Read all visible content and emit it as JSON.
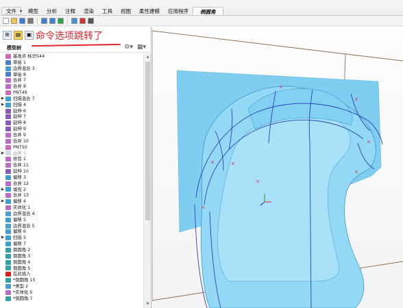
{
  "menu": {
    "items": [
      {
        "label": "文件",
        "dropdown": "▾"
      },
      {
        "label": "模型"
      },
      {
        "label": "分析"
      },
      {
        "label": "注释"
      },
      {
        "label": "渲染"
      },
      {
        "label": "工具"
      },
      {
        "label": "视图"
      },
      {
        "label": "柔性建模"
      },
      {
        "label": "应用程序"
      },
      {
        "label": "倒圆角"
      }
    ],
    "active_index": 9
  },
  "toolbar": {
    "icons": [
      "new-file-icon",
      "open-file-icon",
      "save-icon",
      "print-icon",
      "undo-icon",
      "redo-icon",
      "regenerate-icon",
      "windows-icon",
      "close-window-icon",
      "more-icon"
    ]
  },
  "panel": {
    "annotation": "命令选项跳转了",
    "annotation_color": "#e8242c",
    "tree_title": "模型树"
  },
  "tree": [
    {
      "label": "基准点 标识544",
      "icon": "datum-point-icon",
      "color": "#c96bb6"
    },
    {
      "label": "草绘 1",
      "icon": "sketch-icon",
      "color": "#4a7fc1"
    },
    {
      "label": "边界混合 3",
      "icon": "boundary-blend-icon",
      "color": "#4a9fd0"
    },
    {
      "label": "草绘 8",
      "icon": "sketch-icon",
      "color": "#4a7fc1"
    },
    {
      "label": "合并 7",
      "icon": "merge-icon",
      "color": "#b76ec4"
    },
    {
      "label": "合并 8",
      "icon": "merge-icon",
      "color": "#b76ec4"
    },
    {
      "label": "PNT49",
      "icon": "datum-point-icon",
      "color": "#c96bb6"
    },
    {
      "label": "扫描混合 7",
      "icon": "swept-blend-icon",
      "color": "#3fa0c9",
      "expand": true
    },
    {
      "label": "扫描 4",
      "icon": "sweep-icon",
      "color": "#3fa0c9",
      "expand": true
    },
    {
      "label": "延伸 6",
      "icon": "extend-icon",
      "color": "#8a5ab6"
    },
    {
      "label": "延伸 7",
      "icon": "extend-icon",
      "color": "#8a5ab6"
    },
    {
      "label": "延伸 8",
      "icon": "extend-icon",
      "color": "#8a5ab6"
    },
    {
      "label": "延伸 9",
      "icon": "extend-icon",
      "color": "#8a5ab6"
    },
    {
      "label": "合并 9",
      "icon": "merge-icon",
      "color": "#b76ec4"
    },
    {
      "label": "合并 10",
      "icon": "merge-icon",
      "color": "#b76ec4"
    },
    {
      "label": "PNT50",
      "icon": "datum-point-icon",
      "color": "#c96bb6"
    },
    {
      "label": "边界 5",
      "icon": "boundary-icon",
      "color": "#9ab",
      "expand": true,
      "dim": true
    },
    {
      "label": "修剪 1",
      "icon": "trim-icon",
      "color": "#b76ec4"
    },
    {
      "label": "合并 11",
      "icon": "merge-icon",
      "color": "#b76ec4"
    },
    {
      "label": "延伸 10",
      "icon": "extend-icon",
      "color": "#8a5ab6"
    },
    {
      "label": "偏移 3",
      "icon": "offset-icon",
      "color": "#3fa0c9"
    },
    {
      "label": "合并 12",
      "icon": "merge-icon",
      "color": "#b76ec4"
    },
    {
      "label": "填充 2",
      "icon": "fill-icon",
      "color": "#3fa0c9",
      "expand": true
    },
    {
      "label": "合并 13",
      "icon": "merge-icon",
      "color": "#b76ec4"
    },
    {
      "label": "偏移 4",
      "icon": "offset-icon",
      "color": "#3fa0c9",
      "expand": true
    },
    {
      "label": "实体化 1",
      "icon": "solidify-icon",
      "color": "#b76ec4"
    },
    {
      "label": "边界混合 4",
      "icon": "boundary-blend-icon",
      "color": "#4a9fd0"
    },
    {
      "label": "偏移 5",
      "icon": "offset-icon",
      "color": "#3fa0c9"
    },
    {
      "label": "边界混合 5",
      "icon": "boundary-blend-icon",
      "color": "#4a9fd0"
    },
    {
      "label": "偏移 6",
      "icon": "offset-icon",
      "color": "#3fa0c9"
    },
    {
      "label": "扫描 5",
      "icon": "sweep-icon",
      "color": "#3fa0c9",
      "expand": true
    },
    {
      "label": "偏移 7",
      "icon": "offset-icon",
      "color": "#3fa0c9"
    },
    {
      "label": "倒圆角 2",
      "icon": "round-icon",
      "color": "#35a0a8"
    },
    {
      "label": "倒圆角 3",
      "icon": "round-icon",
      "color": "#35a0a8"
    },
    {
      "label": "倒圆角 4",
      "icon": "round-icon",
      "color": "#35a0a8"
    },
    {
      "label": "倒圆角 5",
      "icon": "round-icon",
      "color": "#35a0a8"
    },
    {
      "label": "在此插入",
      "icon": "insert-here-icon",
      "color": "#d62020"
    },
    {
      "label": "*倒圆角 15",
      "icon": "round-icon",
      "color": "#35a0a8"
    },
    {
      "label": "*类型 2",
      "icon": "type-icon",
      "color": "#3fa0c9"
    },
    {
      "label": "*实体化 5",
      "icon": "solidify-icon",
      "color": "#b76ec4"
    },
    {
      "label": "*倒圆角 7",
      "icon": "round-icon",
      "color": "#35a0a8"
    }
  ],
  "viewport": {
    "background": "#f7f7f7",
    "surface_color": "#8fd6f5",
    "curve_color": "#2b3fb8"
  }
}
